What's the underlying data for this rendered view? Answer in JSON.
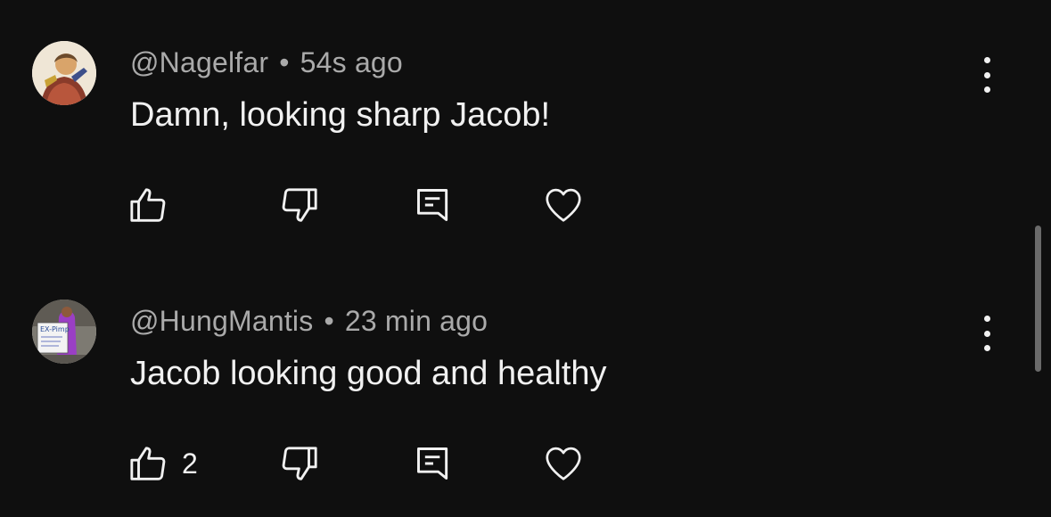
{
  "comments": [
    {
      "author": "@Nagelfar",
      "separator": "•",
      "time": "54s ago",
      "text": "Damn, looking sharp Jacob!",
      "like_count": ""
    },
    {
      "author": "@HungMantis",
      "separator": "•",
      "time": "23 min ago",
      "text": "Jacob looking good and healthy",
      "like_count": "2",
      "avatar_sign_text": "EX-Pimp"
    }
  ],
  "icons": {
    "like": "thumbs-up-icon",
    "dislike": "thumbs-down-icon",
    "reply": "reply-icon",
    "love": "heart-icon",
    "more": "more-vertical-icon"
  },
  "colors": {
    "background": "#0f0f0f",
    "primary_text": "#f1f1f1",
    "secondary_text": "#aaaaaa"
  }
}
